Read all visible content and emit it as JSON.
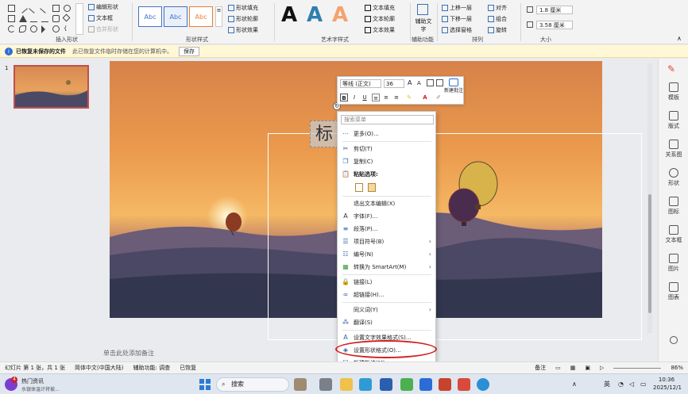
{
  "ribbon": {
    "group_insert_shapes": "插入形状",
    "edit_shape": "编辑形状",
    "text_box": "文本框",
    "merge_shape": "合并形状",
    "style_samples": [
      "Abc",
      "Abc",
      "Abc"
    ],
    "group_shape_styles": "形状样式",
    "shape_fill": "形状填充",
    "shape_outline": "形状轮廓",
    "shape_effects": "形状效果",
    "wordart_samples": [
      "A",
      "A",
      "A"
    ],
    "group_wordart": "艺术字样式",
    "text_fill": "文本填充",
    "text_outline": "文本轮廓",
    "text_effects": "文本效果",
    "alt_text": "辅助文字",
    "group_accessibility": "辅助功能",
    "bring_forward": "上移一层",
    "send_backward": "下移一层",
    "selection_pane": "选择窗格",
    "align": "对齐",
    "group": "组合",
    "rotate": "旋转",
    "group_arrange": "排列",
    "height_value": "1.8 厘米",
    "width_value": "3.58 厘米",
    "group_size": "大小"
  },
  "infobar": {
    "title": "已恢复未保存的文件",
    "message": "此已恢复文件临时存储在您的计算机中。",
    "save_label": "保存"
  },
  "thumbs": {
    "slide_number": "1"
  },
  "slide": {
    "textbox_text": "标"
  },
  "mini_toolbar": {
    "font_name": "等线 (正文)",
    "font_size": "36",
    "bold": "B",
    "italic": "I",
    "underline": "U",
    "new_comment": "新建批注"
  },
  "context_menu": {
    "search_placeholder": "搜索菜单",
    "items": [
      "更多(O)...",
      "剪切(T)",
      "复制(C)",
      "粘贴选项:",
      "退出文本编辑(X)",
      "字体(F)...",
      "段落(P)...",
      "项目符号(B)",
      "编号(N)",
      "转换为 SmartArt(M)",
      "链接(L)",
      "超链接(H)...",
      "同义词(Y)",
      "翻译(S)",
      "设置文字效果格式(S)...",
      "设置形状格式(O)...",
      "新建批注(M)"
    ]
  },
  "rail": {
    "items": [
      "模板",
      "版式",
      "关系图",
      "形状",
      "图标",
      "文本框",
      "图片",
      "图表"
    ]
  },
  "notes": {
    "placeholder": "单击此处添加备注"
  },
  "status": {
    "slide_info": "幻灯片 第 1 张，共 1 张",
    "language": "简体中文(中国大陆)",
    "accessibility": "辅助功能: 调查",
    "recovered": "已恢复",
    "notes_btn": "备注",
    "zoom": "86%"
  },
  "taskbar": {
    "news_title": "热门资讯",
    "news_sub": "水银体温计将被...",
    "news_badge": "4",
    "search_label": "搜索",
    "ime": "英",
    "time": "10:36",
    "date": "2025/12/1"
  },
  "colors": {
    "accent": "#b7472a",
    "highlight": "#d11f1f"
  }
}
